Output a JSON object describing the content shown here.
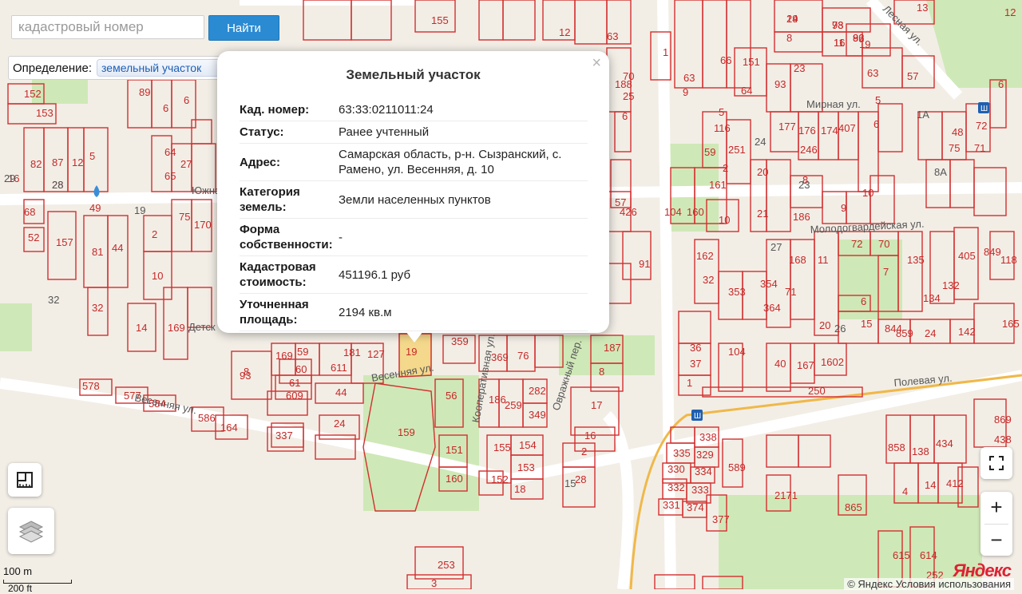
{
  "search": {
    "placeholder": "кадастровый номер",
    "button_label": "Найти"
  },
  "definition": {
    "label": "Определение:",
    "selected": "земельный участок"
  },
  "popup": {
    "title": "Земельный участок",
    "close": "×",
    "rows": [
      {
        "key": "Кад. номер:",
        "value": "63:33:0211011:24"
      },
      {
        "key": "Статус:",
        "value": "Ранее учтенный"
      },
      {
        "key": "Адрес:",
        "value": "Самарская область, р-н. Сызранский, с. Рамено, ул. Весенняя, д. 10"
      },
      {
        "key": "Категория земель:",
        "value": "Земли населенных пунктов"
      },
      {
        "key": "Форма собственности:",
        "value": "-"
      },
      {
        "key": "Кадастровая стоимость:",
        "value": "451196.1 руб"
      },
      {
        "key": "Уточненная площадь:",
        "value": "2194 кв.м"
      }
    ]
  },
  "map": {
    "streets": [
      "Весенняя ул.",
      "Полевая ул.",
      "Молодогвардейская ул.",
      "Мирная ул.",
      "Кооперативная ул.",
      "Овражный пер.",
      "Южная ул.",
      "Лесная ул."
    ],
    "parcels": [
      "14",
      "78",
      "82",
      "16",
      "8",
      "5",
      "57",
      "6",
      "63",
      "66",
      "151",
      "64",
      "93",
      "23",
      "177",
      "176",
      "174",
      "407",
      "6",
      "48",
      "75",
      "72",
      "71",
      "152",
      "153",
      "82",
      "87",
      "12",
      "5",
      "28",
      "49",
      "2",
      "75",
      "170",
      "68",
      "52",
      "157",
      "81",
      "44",
      "10",
      "32",
      "14",
      "169",
      "93",
      "169",
      "59",
      "60",
      "61",
      "609",
      "611",
      "181",
      "127",
      "44",
      "24",
      "19",
      "359",
      "369",
      "76",
      "187",
      "8",
      "17",
      "56",
      "186",
      "259",
      "282",
      "349",
      "159",
      "151",
      "160",
      "155",
      "154",
      "153",
      "152",
      "18",
      "16",
      "2",
      "28",
      "36",
      "37",
      "1",
      "104",
      "40",
      "167",
      "1602",
      "250",
      "578",
      "577",
      "584",
      "586",
      "164",
      "337",
      "335",
      "338",
      "329",
      "330",
      "334",
      "332",
      "333",
      "331",
      "374",
      "589",
      "377",
      "2171",
      "865",
      "858",
      "138",
      "434",
      "869",
      "438",
      "4",
      "14",
      "412",
      "615",
      "614",
      "252",
      "253",
      "3",
      "161",
      "160",
      "10",
      "91",
      "162",
      "32",
      "353",
      "354",
      "364",
      "71",
      "168",
      "11",
      "20",
      "72",
      "70",
      "7",
      "6",
      "15",
      "844",
      "135",
      "134",
      "132",
      "405",
      "849",
      "118",
      "859",
      "24",
      "142",
      "165",
      "186",
      "9",
      "10",
      "20",
      "21",
      "8",
      "246",
      "251",
      "59",
      "116",
      "104",
      "426",
      "57",
      "188",
      "70",
      "25",
      "6",
      "1",
      "9",
      "64",
      "65",
      "27",
      "89",
      "6",
      "6",
      "155",
      "63",
      "12",
      "13",
      "19",
      "63",
      "12",
      "16",
      "8",
      "5",
      "2",
      "29",
      "93",
      "96",
      "11"
    ],
    "point_labels": [
      "8A",
      "1A",
      "27",
      "23",
      "24",
      "26",
      "19",
      "32",
      "29",
      "28",
      "15"
    ],
    "place_label": "Детск",
    "scale_top": "100 m",
    "scale_bottom": "200 ft",
    "copyright": "© Яндекс  Условия использования",
    "logo": "Яндекс"
  },
  "colors": {
    "parcel": "#d32f2f",
    "selected_parcel": "#f5d37a",
    "accent": "#2a8bd3",
    "park": "#cde8b5"
  },
  "icons": [
    "ruler-icon",
    "layers-icon",
    "fullscreen-icon",
    "zoom-in-icon",
    "zoom-out-icon",
    "bus-stop-icon",
    "water-drop-icon"
  ]
}
